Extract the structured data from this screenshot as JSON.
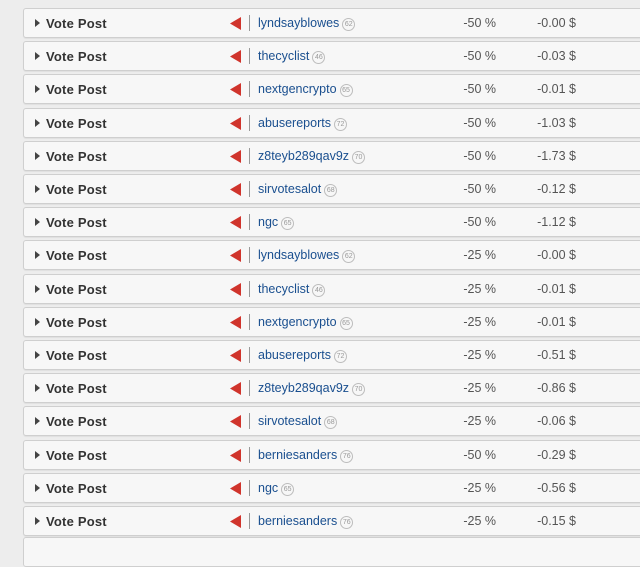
{
  "vote_label": "Vote Post",
  "flag_color": "#d0342c",
  "link_color": "#1a4f8f",
  "rows": [
    {
      "user": "lyndsayblowes",
      "rep": "62",
      "percent": "-50 %",
      "amount": "-0.00 $"
    },
    {
      "user": "thecyclist",
      "rep": "46",
      "percent": "-50 %",
      "amount": "-0.03 $"
    },
    {
      "user": "nextgencrypto",
      "rep": "65",
      "percent": "-50 %",
      "amount": "-0.01 $"
    },
    {
      "user": "abusereports",
      "rep": "72",
      "percent": "-50 %",
      "amount": "-1.03 $"
    },
    {
      "user": "z8teyb289qav9z",
      "rep": "70",
      "percent": "-50 %",
      "amount": "-1.73 $"
    },
    {
      "user": "sirvotesalot",
      "rep": "68",
      "percent": "-50 %",
      "amount": "-0.12 $"
    },
    {
      "user": "ngc",
      "rep": "65",
      "percent": "-50 %",
      "amount": "-1.12 $"
    },
    {
      "user": "lyndsayblowes",
      "rep": "62",
      "percent": "-25 %",
      "amount": "-0.00 $"
    },
    {
      "user": "thecyclist",
      "rep": "46",
      "percent": "-25 %",
      "amount": "-0.01 $"
    },
    {
      "user": "nextgencrypto",
      "rep": "65",
      "percent": "-25 %",
      "amount": "-0.01 $"
    },
    {
      "user": "abusereports",
      "rep": "72",
      "percent": "-25 %",
      "amount": "-0.51 $"
    },
    {
      "user": "z8teyb289qav9z",
      "rep": "70",
      "percent": "-25 %",
      "amount": "-0.86 $"
    },
    {
      "user": "sirvotesalot",
      "rep": "68",
      "percent": "-25 %",
      "amount": "-0.06 $"
    },
    {
      "user": "berniesanders",
      "rep": "76",
      "percent": "-50 %",
      "amount": "-0.29 $"
    },
    {
      "user": "ngc",
      "rep": "65",
      "percent": "-25 %",
      "amount": "-0.56 $"
    },
    {
      "user": "berniesanders",
      "rep": "76",
      "percent": "-25 %",
      "amount": "-0.15 $"
    }
  ]
}
